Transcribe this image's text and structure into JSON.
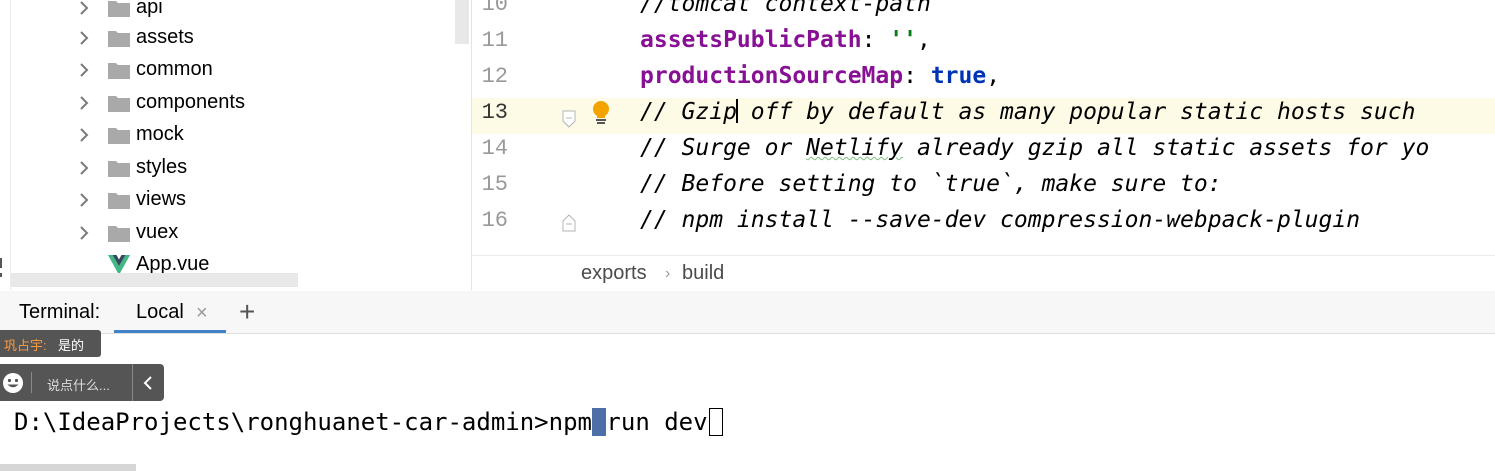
{
  "project_tree": {
    "items": [
      {
        "label": "api",
        "type": "folder"
      },
      {
        "label": "assets",
        "type": "folder"
      },
      {
        "label": "common",
        "type": "folder"
      },
      {
        "label": "components",
        "type": "folder"
      },
      {
        "label": "mock",
        "type": "folder"
      },
      {
        "label": "styles",
        "type": "folder"
      },
      {
        "label": "views",
        "type": "folder"
      },
      {
        "label": "vuex",
        "type": "folder"
      },
      {
        "label": "App.vue",
        "type": "vue-file"
      }
    ]
  },
  "editor": {
    "current_line": "13",
    "lines": [
      {
        "num": "10",
        "text": "//tomcat context-path"
      },
      {
        "num": "11",
        "key": "assetsPublicPath",
        "sep": ": ",
        "str": "''",
        "end": ","
      },
      {
        "num": "12",
        "key": "productionSourceMap",
        "sep": ": ",
        "kw": "true",
        "end": ","
      },
      {
        "num": "13",
        "before_caret": "// Gzip",
        "after_caret": " off by default as many popular static hosts such"
      },
      {
        "num": "14",
        "before": "// Surge or ",
        "squiggle": "Netlify",
        "after": " already gzip all static assets for yo"
      },
      {
        "num": "15",
        "text": "// Before setting to `true`, make sure to:"
      },
      {
        "num": "16",
        "text": "// npm install --save-dev compression-webpack-plugin"
      }
    ]
  },
  "breadcrumb": {
    "items": [
      "exports",
      "build"
    ],
    "separator": "›"
  },
  "terminal": {
    "title": "Terminal:",
    "tabs": [
      {
        "label": "Local",
        "close": "×"
      }
    ],
    "add_tab": "+",
    "prompt_before": "D:\\IdeaProjects\\ronghuanet-car-admin>npm",
    "prompt_selected": " ",
    "prompt_after": "run dev"
  },
  "danmaku": {
    "user": "巩占宇:",
    "message": "是的"
  },
  "chat_bar": {
    "placeholder": "说点什么..."
  },
  "colors": {
    "folder": "#a9a9a9",
    "vue_green": "#41b883",
    "vue_dark": "#35495e",
    "current_line_bg": "#fdfbe6",
    "tab_underline": "#4083c9",
    "selection": "#4d6fa8",
    "overlay_bg": "#555555",
    "bulb": "#f2a300"
  }
}
